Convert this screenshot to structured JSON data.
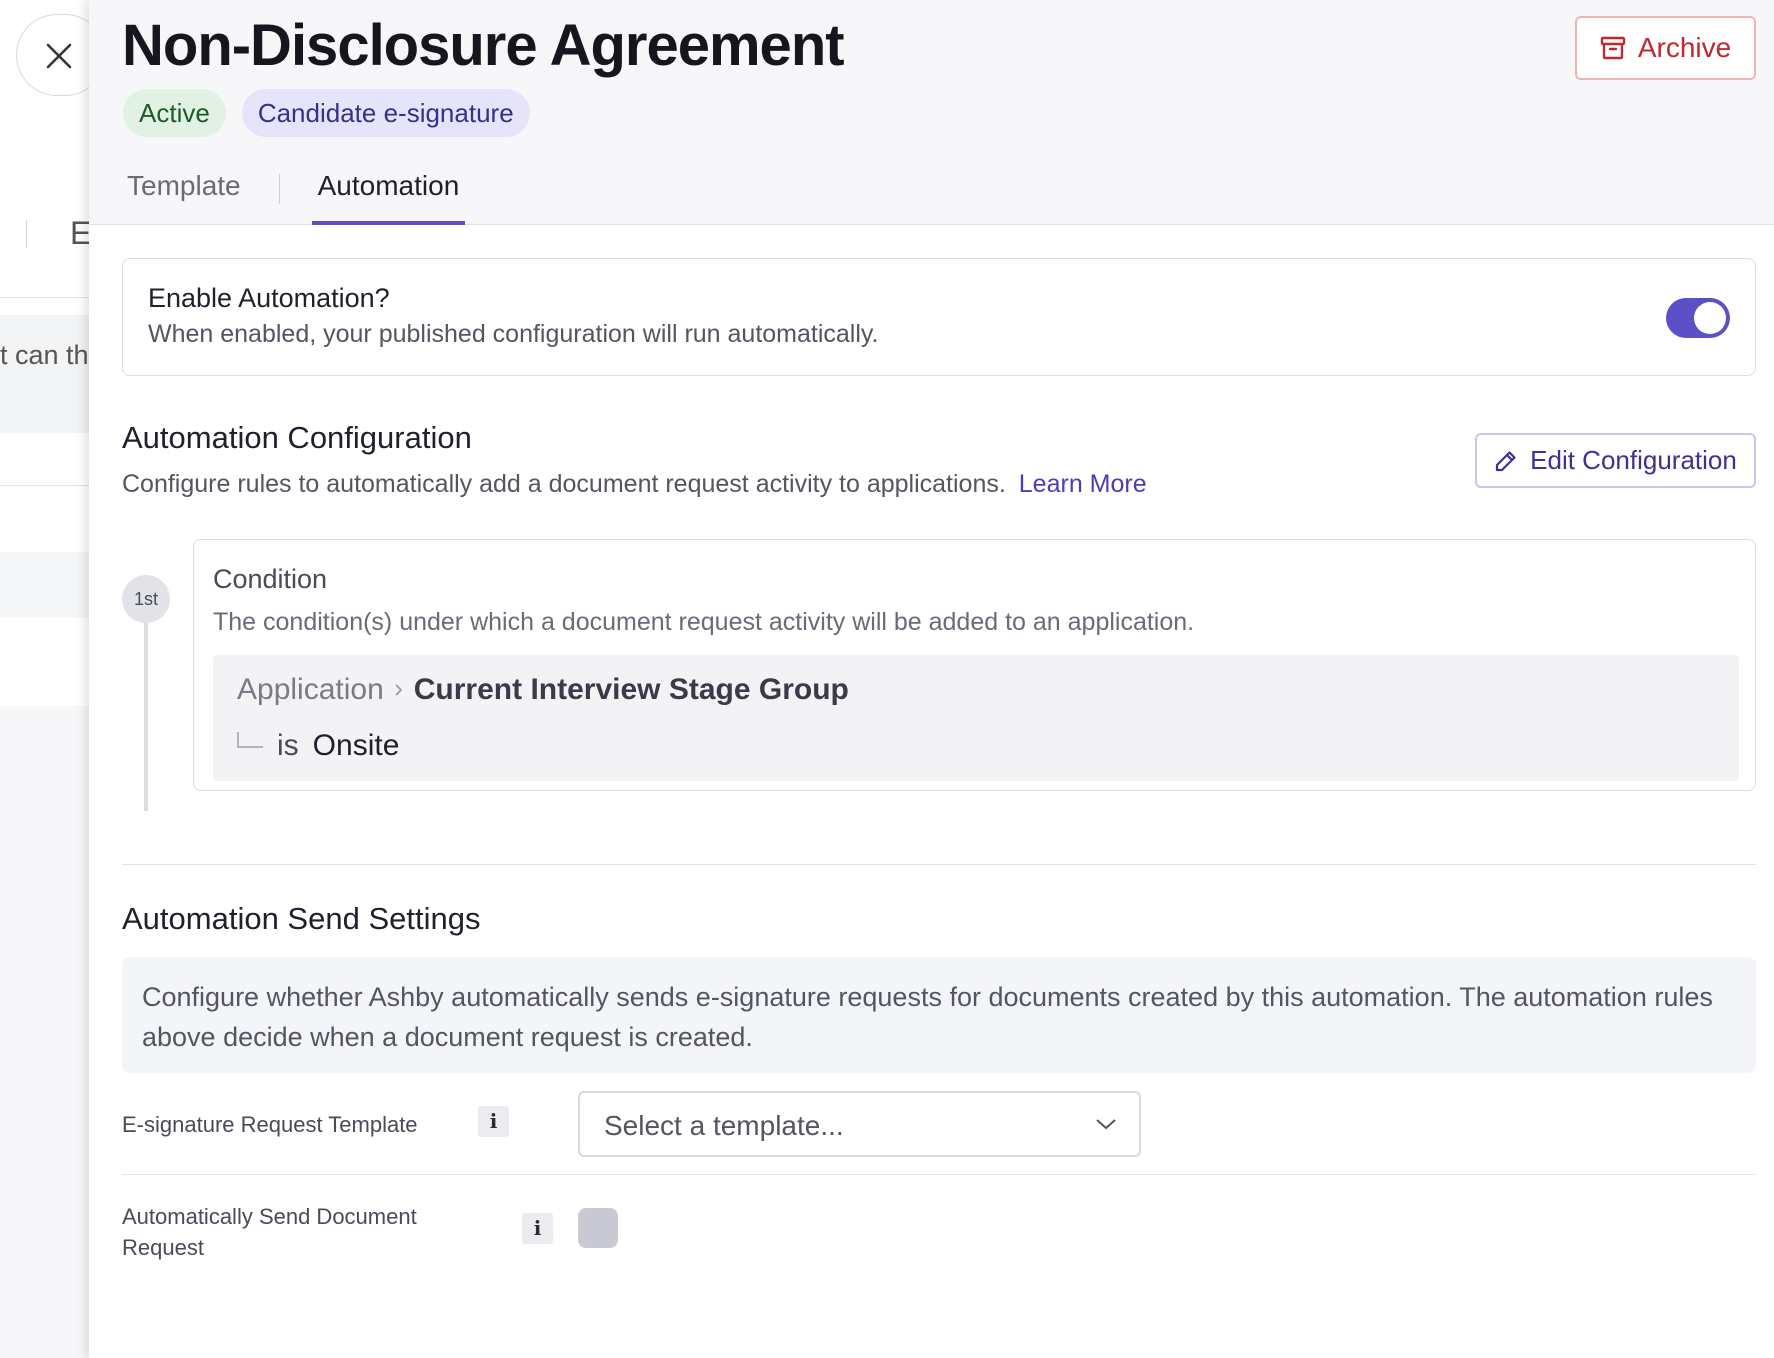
{
  "background": {
    "partial_tab_letter": "E",
    "partial_text": "t can th"
  },
  "drawer": {
    "title": "Non-Disclosure Agreement",
    "badges": {
      "status": "Active",
      "type": "Candidate e-signature"
    },
    "archive_label": "Archive",
    "tabs": [
      {
        "label": "Template",
        "active": false
      },
      {
        "label": "Automation",
        "active": true
      }
    ]
  },
  "enable_automation": {
    "title": "Enable Automation?",
    "description": "When enabled, your published configuration will run automatically.",
    "enabled": true
  },
  "automation_configuration": {
    "title": "Automation Configuration",
    "description": "Configure rules to automatically add a document request activity to applications.",
    "learn_more": "Learn More",
    "edit_label": "Edit Configuration",
    "steps": [
      {
        "order": "1st",
        "title": "Condition",
        "description": "The condition(s) under which a document request activity will be added to an application.",
        "object": "Application",
        "field": "Current Interview Stage Group",
        "operator": "is",
        "value": "Onsite"
      }
    ]
  },
  "send_settings": {
    "title": "Automation Send Settings",
    "info": "Configure whether Ashby automatically sends e-signature requests for documents created by this automation. The automation rules above decide when a document request is created.",
    "template_label": "E-signature Request Template",
    "template_placeholder": "Select a template...",
    "auto_send_label_line1": "Automatically Send Document",
    "auto_send_label_line2": "Request",
    "auto_send_checked": false,
    "info_glyph": "i"
  },
  "colors": {
    "accent": "#5b50c7",
    "archive_red": "#c0282d",
    "active_badge_bg": "#e1f1e3",
    "esig_badge_bg": "#e6e4fb"
  }
}
